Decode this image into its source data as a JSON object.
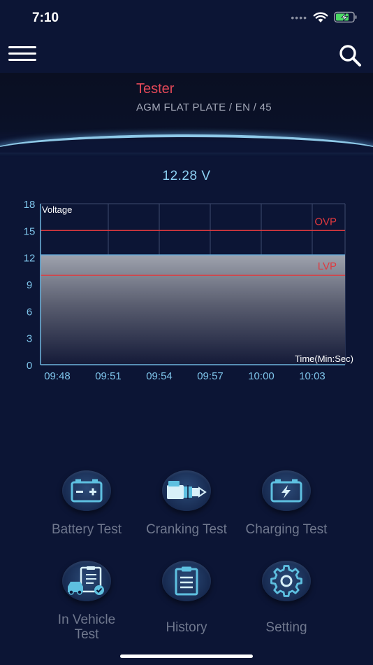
{
  "status_bar": {
    "time": "7:10",
    "signal_dots": "••••"
  },
  "device": {
    "name": "Tester",
    "spec": "AGM FLAT PLATE / EN / 45"
  },
  "voltage_reading": "12.28 V",
  "chart_data": {
    "type": "area",
    "ylabel": "Voltage",
    "xlabel": "Time(Min:Sec)",
    "ylim": [
      0,
      18
    ],
    "y_ticks": [
      "0",
      "3",
      "6",
      "9",
      "12",
      "15",
      "18"
    ],
    "x_ticks": [
      "09:48",
      "09:51",
      "09:54",
      "09:57",
      "10:00",
      "10:03"
    ],
    "value": 12.28,
    "thresholds": [
      {
        "label": "OVP",
        "value": 15
      },
      {
        "label": "LVP",
        "value": 10
      }
    ],
    "grid": true,
    "colors": {
      "grid": "#3e4a6e",
      "axis": "#6fb5de",
      "threshold": "#e0393e",
      "tick_label": "#7ec4ea"
    }
  },
  "menu": {
    "items": [
      {
        "label": "Battery Test",
        "icon": "battery-icon"
      },
      {
        "label": "Cranking Test",
        "icon": "starter-motor-icon"
      },
      {
        "label": "Charging Test",
        "icon": "charging-battery-icon"
      },
      {
        "label": "In Vehicle Test",
        "icon": "vehicle-checklist-icon"
      },
      {
        "label": "History",
        "icon": "clipboard-icon"
      },
      {
        "label": "Setting",
        "icon": "gear-icon"
      }
    ]
  }
}
